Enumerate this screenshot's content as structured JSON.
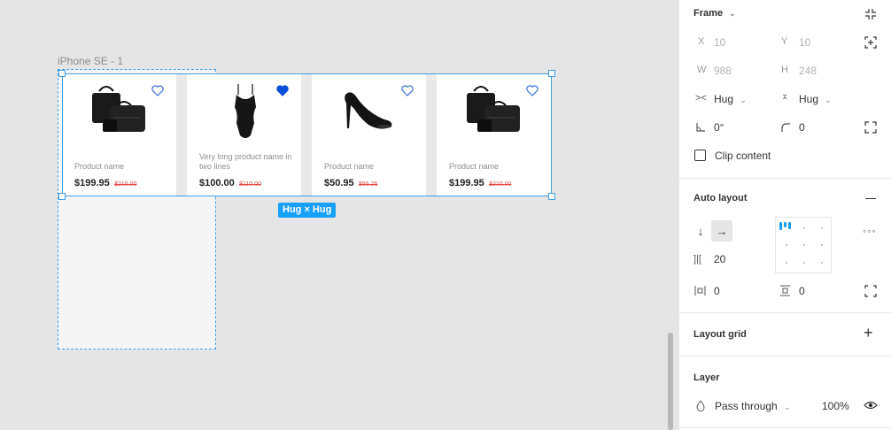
{
  "canvas": {
    "frame_label": "iPhone SE - 1",
    "size_badge": "Hug × Hug",
    "products": [
      {
        "name": "Product name",
        "price": "$199.95",
        "old_price": "$210.00",
        "liked": false,
        "image": "handbag-set"
      },
      {
        "name": "Very long product name in two lines",
        "price": "$100.00",
        "old_price": "$110.00",
        "liked": true,
        "image": "swimsuit"
      },
      {
        "name": "Product name",
        "price": "$50.95",
        "old_price": "$55.25",
        "liked": false,
        "image": "high-heel-shoe"
      },
      {
        "name": "Product name",
        "price": "$199.95",
        "old_price": "$210.00",
        "liked": false,
        "image": "handbag-set"
      }
    ]
  },
  "panel": {
    "frame": {
      "title": "Frame",
      "x_label": "X",
      "x_value": "10",
      "y_label": "Y",
      "y_value": "10",
      "w_label": "W",
      "w_value": "988",
      "h_label": "H",
      "h_value": "248",
      "width_mode": "Hug",
      "height_mode": "Hug",
      "rotation": "0°",
      "radius": "0",
      "clip_content": "Clip content"
    },
    "auto_layout": {
      "title": "Auto layout",
      "spacing": "20",
      "padding_horizontal": "0",
      "padding_vertical": "0"
    },
    "layout_grid": {
      "title": "Layout grid"
    },
    "layer": {
      "title": "Layer",
      "blend_mode": "Pass through",
      "opacity": "100%"
    }
  },
  "colors": {
    "selection": "#3da0e8",
    "badge": "#18a0fb",
    "liked_heart": "#0b4fd9",
    "old_price": "#e44848"
  }
}
